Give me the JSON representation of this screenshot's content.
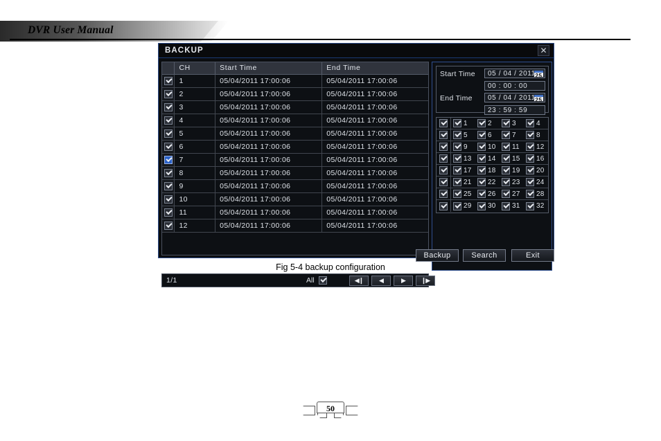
{
  "document": {
    "header_title": "DVR User Manual",
    "figure_caption": "Fig 5-4 backup configuration",
    "page_number": "50"
  },
  "dialog": {
    "title": "BACKUP",
    "close_icon": "close-icon",
    "close_glyph": "✕"
  },
  "table": {
    "columns": [
      "",
      "CH",
      "Start Time",
      "End Time"
    ],
    "rows": [
      {
        "checked": true,
        "focused": false,
        "ch": "1",
        "start": "05/04/2011 17:00:06",
        "end": "05/04/2011 17:00:06"
      },
      {
        "checked": true,
        "focused": false,
        "ch": "2",
        "start": "05/04/2011 17:00:06",
        "end": "05/04/2011 17:00:06"
      },
      {
        "checked": true,
        "focused": false,
        "ch": "3",
        "start": "05/04/2011 17:00:06",
        "end": "05/04/2011 17:00:06"
      },
      {
        "checked": true,
        "focused": false,
        "ch": "4",
        "start": "05/04/2011 17:00:06",
        "end": "05/04/2011 17:00:06"
      },
      {
        "checked": true,
        "focused": false,
        "ch": "5",
        "start": "05/04/2011 17:00:06",
        "end": "05/04/2011 17:00:06"
      },
      {
        "checked": true,
        "focused": false,
        "ch": "6",
        "start": "05/04/2011 17:00:06",
        "end": "05/04/2011 17:00:06"
      },
      {
        "checked": true,
        "focused": true,
        "ch": "7",
        "start": "05/04/2011 17:00:06",
        "end": "05/04/2011 17:00:06"
      },
      {
        "checked": true,
        "focused": false,
        "ch": "8",
        "start": "05/04/2011 17:00:06",
        "end": "05/04/2011 17:00:06"
      },
      {
        "checked": true,
        "focused": false,
        "ch": "9",
        "start": "05/04/2011 17:00:06",
        "end": "05/04/2011 17:00:06"
      },
      {
        "checked": true,
        "focused": false,
        "ch": "10",
        "start": "05/04/2011 17:00:06",
        "end": "05/04/2011 17:00:06"
      },
      {
        "checked": true,
        "focused": false,
        "ch": "11",
        "start": "05/04/2011 17:00:06",
        "end": "05/04/2011 17:00:06"
      },
      {
        "checked": true,
        "focused": false,
        "ch": "12",
        "start": "05/04/2011 17:00:06",
        "end": "05/04/2011 17:00:06"
      }
    ]
  },
  "statusbar": {
    "page_indicator": "1/1",
    "all_label": "All",
    "all_checked": true,
    "nav": [
      {
        "name": "first-page-button",
        "glyph": "◀❙"
      },
      {
        "name": "prev-page-button",
        "glyph": "◀"
      },
      {
        "name": "next-page-button",
        "glyph": "▶"
      },
      {
        "name": "last-page-button",
        "glyph": "❙▶"
      }
    ]
  },
  "time_panel": {
    "start_label": "Start Time",
    "end_label": "End Time",
    "start_date": "05 / 04 / 2011",
    "start_time": "00 : 00 : 00",
    "end_date": "05 / 04 / 2011",
    "end_time": "23 : 59 : 59",
    "calendar_icon_label": "25"
  },
  "channel_grid": {
    "rows": [
      {
        "all_checked": true,
        "cells": [
          {
            "n": "1",
            "checked": true
          },
          {
            "n": "2",
            "checked": true
          },
          {
            "n": "3",
            "checked": true
          },
          {
            "n": "4",
            "checked": true
          }
        ]
      },
      {
        "all_checked": true,
        "cells": [
          {
            "n": "5",
            "checked": true
          },
          {
            "n": "6",
            "checked": true
          },
          {
            "n": "7",
            "checked": true
          },
          {
            "n": "8",
            "checked": true
          }
        ]
      },
      {
        "all_checked": true,
        "cells": [
          {
            "n": "9",
            "checked": true
          },
          {
            "n": "10",
            "checked": true
          },
          {
            "n": "11",
            "checked": true
          },
          {
            "n": "12",
            "checked": true
          }
        ]
      },
      {
        "all_checked": true,
        "cells": [
          {
            "n": "13",
            "checked": true
          },
          {
            "n": "14",
            "checked": true
          },
          {
            "n": "15",
            "checked": true
          },
          {
            "n": "16",
            "checked": true
          }
        ]
      },
      {
        "all_checked": true,
        "cells": [
          {
            "n": "17",
            "checked": true
          },
          {
            "n": "18",
            "checked": true
          },
          {
            "n": "19",
            "checked": true
          },
          {
            "n": "20",
            "checked": true
          }
        ]
      },
      {
        "all_checked": true,
        "cells": [
          {
            "n": "21",
            "checked": true
          },
          {
            "n": "22",
            "checked": true
          },
          {
            "n": "23",
            "checked": true
          },
          {
            "n": "24",
            "checked": true
          }
        ]
      },
      {
        "all_checked": true,
        "cells": [
          {
            "n": "25",
            "checked": true
          },
          {
            "n": "26",
            "checked": true
          },
          {
            "n": "27",
            "checked": true
          },
          {
            "n": "28",
            "checked": true
          }
        ]
      },
      {
        "all_checked": true,
        "cells": [
          {
            "n": "29",
            "checked": true
          },
          {
            "n": "30",
            "checked": true
          },
          {
            "n": "31",
            "checked": true
          },
          {
            "n": "32",
            "checked": true
          }
        ]
      }
    ]
  },
  "actions": {
    "backup_label": "Backup",
    "search_label": "Search",
    "exit_label": "Exit"
  },
  "colors": {
    "dialog_bg": "#0b0d10",
    "dialog_border": "#2f4f8f",
    "header_bg": "#30343d",
    "text": "#dfe3e9",
    "focus_blue": "#2b62c8"
  }
}
